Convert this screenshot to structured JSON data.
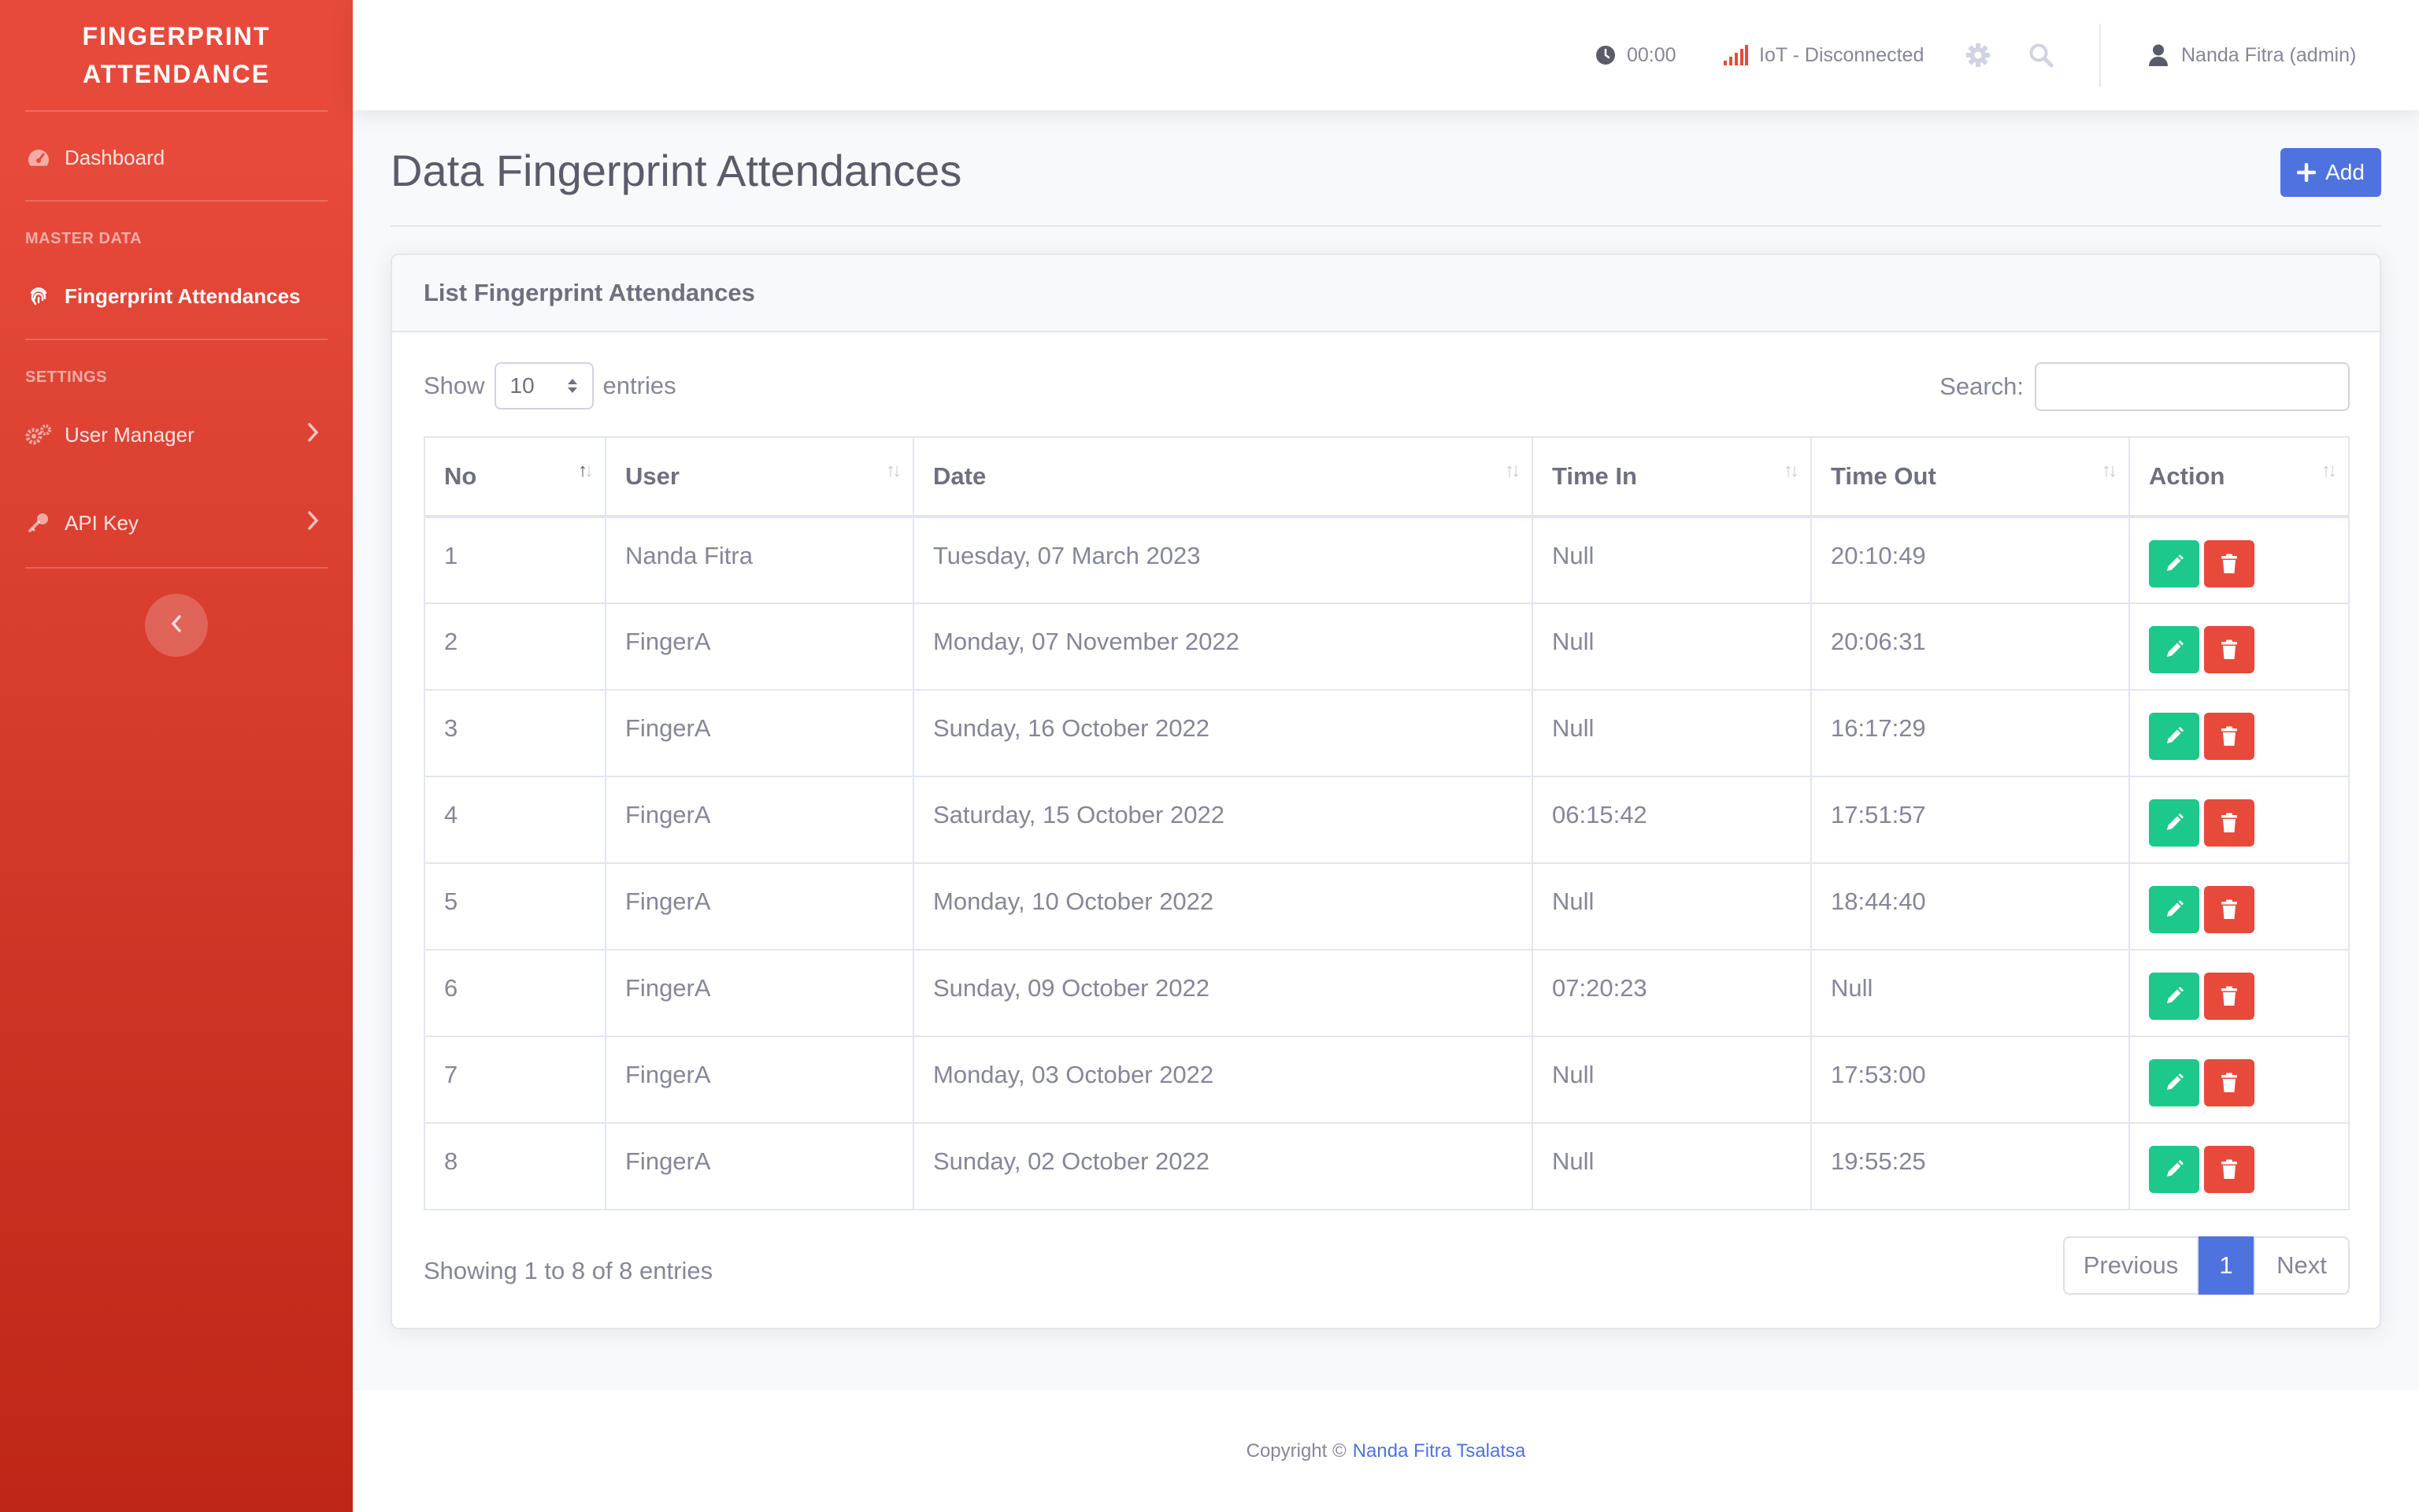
{
  "brand": {
    "line1": "FINGERPRINT",
    "line2": "ATTENDANCE"
  },
  "sidebar": {
    "dashboard": "Dashboard",
    "heading_master": "MASTER DATA",
    "fingerprint": "Fingerprint Attendances",
    "heading_settings": "SETTINGS",
    "user_manager": "User Manager",
    "api_key": "API Key"
  },
  "topbar": {
    "clock": "00:00",
    "iot_status": "IoT - Disconnected",
    "user": "Nanda Fitra (admin)"
  },
  "page": {
    "title": "Data Fingerprint Attendances",
    "add_label": "Add"
  },
  "card": {
    "title": "List Fingerprint Attendances",
    "show_label": "Show",
    "entries_value": "10",
    "entries_label": "entries",
    "search_label": "Search:",
    "search_value": ""
  },
  "table": {
    "columns": [
      "No",
      "User",
      "Date",
      "Time In",
      "Time Out",
      "Action"
    ],
    "rows": [
      [
        "1",
        "Nanda Fitra",
        "Tuesday, 07 March 2023",
        "Null",
        "20:10:49"
      ],
      [
        "2",
        "FingerA",
        "Monday, 07 November 2022",
        "Null",
        "20:06:31"
      ],
      [
        "3",
        "FingerA",
        "Sunday, 16 October 2022",
        "Null",
        "16:17:29"
      ],
      [
        "4",
        "FingerA",
        "Saturday, 15 October 2022",
        "06:15:42",
        "17:51:57"
      ],
      [
        "5",
        "FingerA",
        "Monday, 10 October 2022",
        "Null",
        "18:44:40"
      ],
      [
        "6",
        "FingerA",
        "Sunday, 09 October 2022",
        "07:20:23",
        "Null"
      ],
      [
        "7",
        "FingerA",
        "Monday, 03 October 2022",
        "Null",
        "17:53:00"
      ],
      [
        "8",
        "FingerA",
        "Sunday, 02 October 2022",
        "Null",
        "19:55:25"
      ]
    ]
  },
  "info": "Showing 1 to 8 of 8 entries",
  "pagination": {
    "previous": "Previous",
    "current": "1",
    "next": "Next"
  },
  "footer": {
    "prefix": "Copyright ©",
    "author": "Nanda Fitra Tsalatsa"
  },
  "colors": {
    "sidebar": "#e74a3b",
    "primary": "#4e73df",
    "success": "#1cc88a",
    "danger": "#e74a3b"
  }
}
